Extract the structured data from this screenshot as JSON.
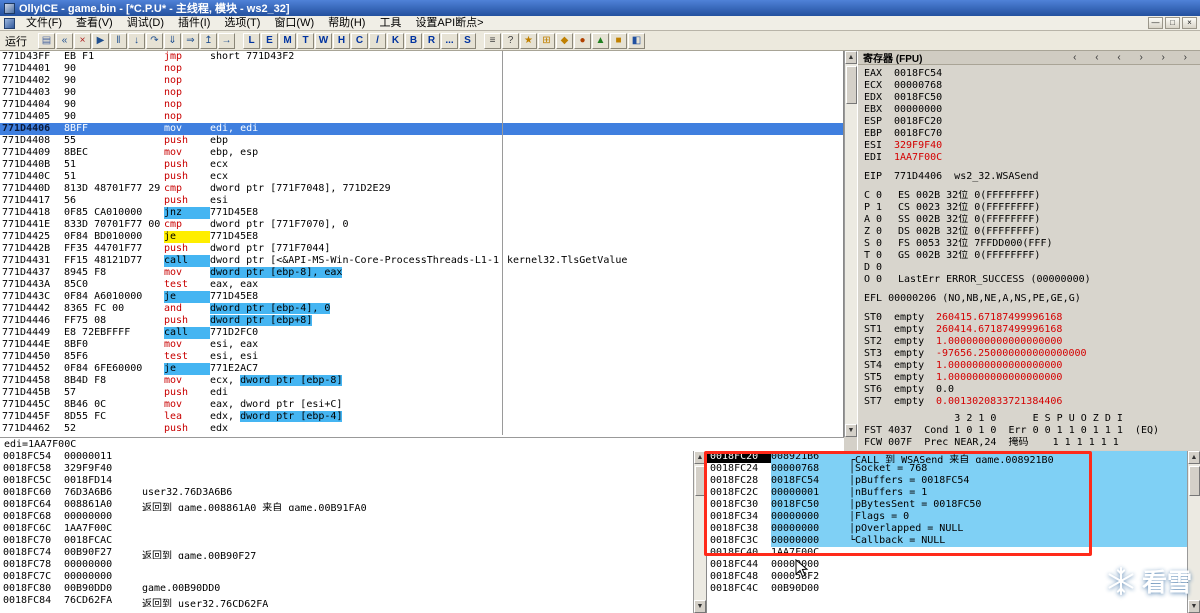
{
  "window": {
    "title": "OllyICE - game.bin - [*C.P.U* - 主线程, 模块 - ws2_32]",
    "controls": [
      {
        "name": "minimize-button",
        "glyph": "—"
      },
      {
        "name": "restore-button",
        "glyph": "□"
      },
      {
        "name": "close-button",
        "glyph": "×"
      }
    ]
  },
  "menu": {
    "items": [
      "文件(F)",
      "查看(V)",
      "调试(D)",
      "插件(I)",
      "选项(T)",
      "窗口(W)",
      "帮助(H)",
      "工具",
      "设置API断点>"
    ]
  },
  "toolbar": {
    "status_label": "运行",
    "icons_left": [
      {
        "name": "open-file-button",
        "glyph": "▤",
        "color": "#4a66a0"
      },
      {
        "name": "restart-button",
        "glyph": "«",
        "color": "#205090"
      },
      {
        "name": "close-program-button",
        "glyph": "×",
        "color": "#b02020"
      },
      {
        "name": "run-button",
        "glyph": "▶",
        "color": "#205090"
      },
      {
        "name": "pause-button",
        "glyph": "‖",
        "color": "#205090"
      },
      {
        "name": "step-into-button",
        "glyph": "↓",
        "color": "#205090"
      },
      {
        "name": "step-over-button",
        "glyph": "↷",
        "color": "#205090"
      },
      {
        "name": "trace-into-button",
        "glyph": "⇓",
        "color": "#205090"
      },
      {
        "name": "trace-over-button",
        "glyph": "⇒",
        "color": "#205090"
      },
      {
        "name": "till-return-button",
        "glyph": "↥",
        "color": "#205090"
      },
      {
        "name": "goto-address-button",
        "glyph": "→",
        "color": "#205090"
      }
    ],
    "letters": [
      "L",
      "E",
      "M",
      "T",
      "W",
      "H",
      "C",
      "/",
      "K",
      "B",
      "R",
      "...",
      "S"
    ],
    "icons_right": [
      {
        "name": "log-options-button",
        "glyph": "≡",
        "color": "#404040"
      },
      {
        "name": "help-button",
        "glyph": "?",
        "color": "#404040"
      },
      {
        "name": "plugin-button-1",
        "glyph": "★",
        "color": "#c08000"
      },
      {
        "name": "plugin-button-2",
        "glyph": "⊞",
        "color": "#c08000"
      },
      {
        "name": "plugin-button-3",
        "glyph": "◆",
        "color": "#c08000"
      },
      {
        "name": "plugin-button-4",
        "glyph": "●",
        "color": "#b04000"
      },
      {
        "name": "plugin-button-5",
        "glyph": "▲",
        "color": "#208020"
      },
      {
        "name": "plugin-button-6",
        "glyph": "■",
        "color": "#c08000"
      },
      {
        "name": "plugin-button-7",
        "glyph": "◧",
        "color": "#2050a0"
      }
    ]
  },
  "disasm": {
    "info_line": "edi=1AA7F00C",
    "rows": [
      {
        "addr": "771D43FF",
        "bytes": "EB F1",
        "mn": "jmp",
        "op_pre": "short 771D43F2"
      },
      {
        "addr": "771D4401",
        "bytes": "90",
        "mn": "nop"
      },
      {
        "addr": "771D4402",
        "bytes": "90",
        "mn": "nop"
      },
      {
        "addr": "771D4403",
        "bytes": "90",
        "mn": "nop"
      },
      {
        "addr": "771D4404",
        "bytes": "90",
        "mn": "nop"
      },
      {
        "addr": "771D4405",
        "bytes": "90",
        "mn": "nop"
      },
      {
        "addr": "771D4406",
        "bytes": "8BFF",
        "mn": "mov",
        "op_pre": "edi, edi",
        "sel": true
      },
      {
        "addr": "771D4408",
        "bytes": "55",
        "mn": "push",
        "op_pre": "ebp"
      },
      {
        "addr": "771D4409",
        "bytes": "8BEC",
        "mn": "mov",
        "op_pre": "ebp, esp"
      },
      {
        "addr": "771D440B",
        "bytes": "51",
        "mn": "push",
        "op_pre": "ecx"
      },
      {
        "addr": "771D440C",
        "bytes": "51",
        "mn": "push",
        "op_pre": "ecx"
      },
      {
        "addr": "771D440D",
        "bytes": "813D 48701F77 29",
        "mn": "cmp",
        "op_pre": "dword ptr [771F7048], 771D2E29"
      },
      {
        "addr": "771D4417",
        "bytes": "56",
        "mn": "push",
        "op_pre": "esi"
      },
      {
        "addr": "771D4418",
        "bytes": "0F85 CA010000",
        "mn": "jnz",
        "mn_cyan": true,
        "op_pre": "771D45E8"
      },
      {
        "addr": "771D441E",
        "bytes": "833D 70701F77 00",
        "mn": "cmp",
        "op_pre": "dword ptr [771F7070], 0"
      },
      {
        "addr": "771D4425",
        "bytes": "0F84 BD010000",
        "mn": "je",
        "mn_yellow": true,
        "op_pre": "771D45E8"
      },
      {
        "addr": "771D442B",
        "bytes": "FF35 44701F77",
        "mn": "push",
        "op_pre": "dword ptr [771F7044]"
      },
      {
        "addr": "771D4431",
        "bytes": "FF15 48121D77",
        "mn": "call",
        "mn_cyan": true,
        "op_pre": "dword ptr [<&API-MS-Win-Core-ProcessThreads-L1-1",
        "comment": "kernel32.TlsGetValue"
      },
      {
        "addr": "771D4437",
        "bytes": "8945 F8",
        "mn": "mov",
        "op_hl": "dword ptr [ebp-8], eax"
      },
      {
        "addr": "771D443A",
        "bytes": "85C0",
        "mn": "test",
        "op_pre": "eax, eax"
      },
      {
        "addr": "771D443C",
        "bytes": "0F84 A6010000",
        "mn": "je",
        "mn_cyan": true,
        "op_pre": "771D45E8"
      },
      {
        "addr": "771D4442",
        "bytes": "8365 FC 00",
        "mn": "and",
        "op_hl": "dword ptr [ebp-4], 0"
      },
      {
        "addr": "771D4446",
        "bytes": "FF75 08",
        "mn": "push",
        "op_hl": "dword ptr [ebp+8]"
      },
      {
        "addr": "771D4449",
        "bytes": "E8 72EBFFFF",
        "mn": "call",
        "mn_cyan": true,
        "op_pre": "771D2FC0"
      },
      {
        "addr": "771D444E",
        "bytes": "8BF0",
        "mn": "mov",
        "op_pre": "esi, eax"
      },
      {
        "addr": "771D4450",
        "bytes": "85F6",
        "mn": "test",
        "op_pre": "esi, esi"
      },
      {
        "addr": "771D4452",
        "bytes": "0F84 6FE60000",
        "mn": "je",
        "mn_cyan": true,
        "op_pre": "771E2AC7"
      },
      {
        "addr": "771D4458",
        "bytes": "8B4D F8",
        "mn": "mov",
        "op_pre": "ecx, ",
        "op_hl": "dword ptr [ebp-8]"
      },
      {
        "addr": "771D445B",
        "bytes": "57",
        "mn": "push",
        "op_pre": "edi"
      },
      {
        "addr": "771D445C",
        "bytes": "8B46 0C",
        "mn": "mov",
        "op_pre": "eax, dword ptr [esi+C]"
      },
      {
        "addr": "771D445F",
        "bytes": "8D55 FC",
        "mn": "lea",
        "op_pre": "edx, ",
        "op_hl": "dword ptr [ebp-4]"
      },
      {
        "addr": "771D4462",
        "bytes": "52",
        "mn": "push",
        "op_pre": "edx"
      }
    ]
  },
  "registers": {
    "title": "寄存器 (FPU)",
    "pane_arrows": "‹ ‹ ‹ › › ›",
    "gpr": [
      {
        "name": "EAX",
        "value": "0018FC54"
      },
      {
        "name": "ECX",
        "value": "00000768"
      },
      {
        "name": "EDX",
        "value": "0018FC50"
      },
      {
        "name": "EBX",
        "value": "00000000"
      },
      {
        "name": "ESP",
        "value": "0018FC20"
      },
      {
        "name": "EBP",
        "value": "0018FC70"
      },
      {
        "name": "ESI",
        "value": "329F9F40",
        "red": true
      },
      {
        "name": "EDI",
        "value": "1AA7F00C",
        "red": true
      }
    ],
    "eip": {
      "name": "EIP",
      "value": "771D4406",
      "comment": "ws2_32.WSASend"
    },
    "flags": [
      {
        "l": "C 0",
        "r": "ES 002B 32位 0(FFFFFFFF)"
      },
      {
        "l": "P 1",
        "r": "CS 0023 32位 0(FFFFFFFF)"
      },
      {
        "l": "A 0",
        "r": "SS 002B 32位 0(FFFFFFFF)"
      },
      {
        "l": "Z 0",
        "r": "DS 002B 32位 0(FFFFFFFF)"
      },
      {
        "l": "S 0",
        "r": "FS 0053 32位 7FFDD000(FFF)"
      },
      {
        "l": "T 0",
        "r": "GS 002B 32位 0(FFFFFFFF)"
      },
      {
        "l": "D 0",
        "r": ""
      },
      {
        "l": "O 0",
        "r": "LastErr ERROR_SUCCESS (00000000)"
      }
    ],
    "efl": "EFL 00000206 (NO,NB,NE,A,NS,PE,GE,G)",
    "fpu": [
      {
        "name": "ST0",
        "tag": "empty",
        "value": "260415.67187499996168",
        "red": true
      },
      {
        "name": "ST1",
        "tag": "empty",
        "value": "260414.67187499996168",
        "red": true
      },
      {
        "name": "ST2",
        "tag": "empty",
        "value": "1.0000000000000000000",
        "red": true
      },
      {
        "name": "ST3",
        "tag": "empty",
        "value": "-97656.250000000000000000",
        "red": true
      },
      {
        "name": "ST4",
        "tag": "empty",
        "value": "1.0000000000000000000",
        "red": true
      },
      {
        "name": "ST5",
        "tag": "empty",
        "value": "1.0000000000000000000",
        "red": true
      },
      {
        "name": "ST6",
        "tag": "empty",
        "value": "0.0"
      },
      {
        "name": "ST7",
        "tag": "empty",
        "value": "0.0013020833721384406",
        "red": true
      }
    ],
    "fpu_cols": "               3 2 1 0      E S P U O Z D I",
    "fst": "FST 4037  Cond 1 0 1 0  Err 0 0 1 1 0 1 1 1  (EQ)",
    "fcw": "FCW 007F  Prec NEAR,24  掩码    1 1 1 1 1 1"
  },
  "dump": {
    "rows": [
      {
        "addr": "0018FC54",
        "value": "00000011",
        "comment": ""
      },
      {
        "addr": "0018FC58",
        "value": "329F9F40",
        "comment": ""
      },
      {
        "addr": "0018FC5C",
        "value": "0018FD14",
        "comment": ""
      },
      {
        "addr": "0018FC60",
        "value": "76D3A6B6",
        "comment": "user32.76D3A6B6"
      },
      {
        "addr": "0018FC64",
        "value": "008861A0",
        "comment": "返回到 game.008861A0 来自 game.00B91FA0"
      },
      {
        "addr": "0018FC68",
        "value": "00000000",
        "comment": ""
      },
      {
        "addr": "0018FC6C",
        "value": "1AA7F00C",
        "comment": ""
      },
      {
        "addr": "0018FC70",
        "value": "0018FCAC",
        "comment": ""
      },
      {
        "addr": "0018FC74",
        "value": "00B90F27",
        "comment": "返回到 game.00B90F27"
      },
      {
        "addr": "0018FC78",
        "value": "00000000",
        "comment": ""
      },
      {
        "addr": "0018FC7C",
        "value": "00000000",
        "comment": ""
      },
      {
        "addr": "0018FC80",
        "value": "00B90DD0",
        "comment": "game.00B90DD0"
      },
      {
        "addr": "0018FC84",
        "value": "76CD62FA",
        "comment": "返回到 user32.76CD62FA"
      }
    ]
  },
  "stack": {
    "rows": [
      {
        "addr": "0018FC20",
        "value": "008921B6",
        "comment": "┌CALL 到 WSASend 来自 game.008921B0",
        "sel": true,
        "hl": true
      },
      {
        "addr": "0018FC24",
        "value": "00000768",
        "comment": "│Socket = 768",
        "hl": true
      },
      {
        "addr": "0018FC28",
        "value": "0018FC54",
        "comment": "│pBuffers = 0018FC54",
        "hl": true
      },
      {
        "addr": "0018FC2C",
        "value": "00000001",
        "comment": "│nBuffers = 1",
        "hl": true
      },
      {
        "addr": "0018FC30",
        "value": "0018FC50",
        "comment": "│pBytesSent = 0018FC50",
        "hl": true
      },
      {
        "addr": "0018FC34",
        "value": "00000000",
        "comment": "│Flags = 0",
        "hl": true
      },
      {
        "addr": "0018FC38",
        "value": "00000000",
        "comment": "│pOverlapped = NULL",
        "hl": true
      },
      {
        "addr": "0018FC3C",
        "value": "00000000",
        "comment": "└Callback = NULL",
        "hl": true
      },
      {
        "addr": "0018FC40",
        "value": "1AA7F00C",
        "comment": ""
      },
      {
        "addr": "0018FC44",
        "value": "00000000",
        "comment": ""
      },
      {
        "addr": "0018FC48",
        "value": "000058F2",
        "comment": ""
      },
      {
        "addr": "0018FC4C",
        "value": "00B90D00",
        "comment": ""
      }
    ]
  },
  "watermark": {
    "text": "看雪"
  }
}
